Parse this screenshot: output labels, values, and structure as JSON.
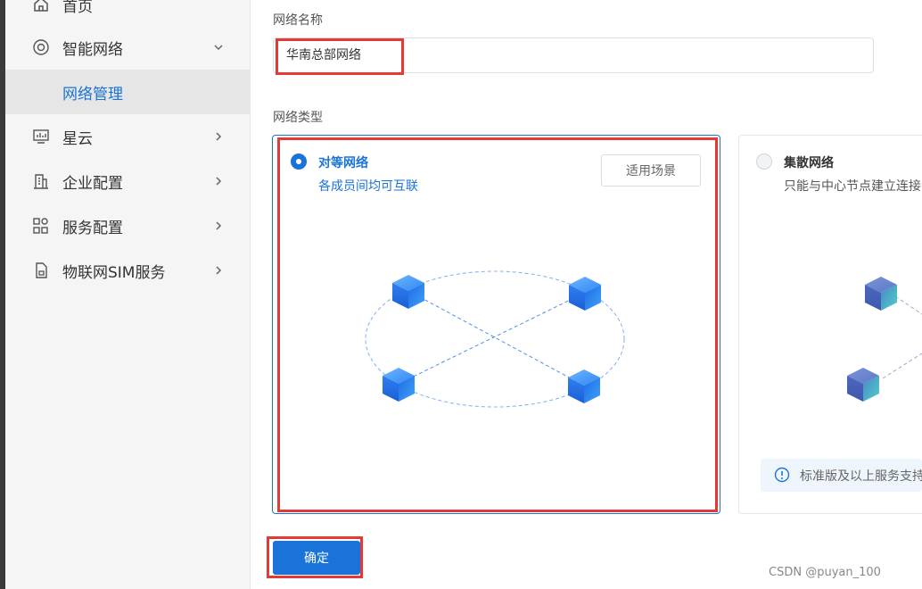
{
  "sidebar": {
    "items": [
      {
        "label": "首页",
        "icon": "home-icon"
      },
      {
        "label": "智能网络",
        "icon": "smart-network-icon",
        "expanded": true
      },
      {
        "label": "网络管理",
        "active": true
      },
      {
        "label": "星云",
        "icon": "monitor-icon"
      },
      {
        "label": "企业配置",
        "icon": "building-icon"
      },
      {
        "label": "服务配置",
        "icon": "grid-icon"
      },
      {
        "label": "物联网SIM服务",
        "icon": "sim-icon"
      }
    ]
  },
  "form": {
    "name_label": "网络名称",
    "name_value": "华南总部网络",
    "type_label": "网络类型"
  },
  "types": [
    {
      "title": "对等网络",
      "desc": "各成员间均可互联",
      "selected": true,
      "scene_button": "适用场景"
    },
    {
      "title": "集散网络",
      "desc": "只能与中心节点建立连接",
      "selected": false,
      "notice": "标准版及以上服务支持"
    }
  ],
  "confirm_label": "确定",
  "watermark": "CSDN @puyan_100",
  "colors": {
    "accent": "#1a73d9",
    "highlight": "#e53935",
    "sidebar_bg": "#f5f5f5"
  }
}
